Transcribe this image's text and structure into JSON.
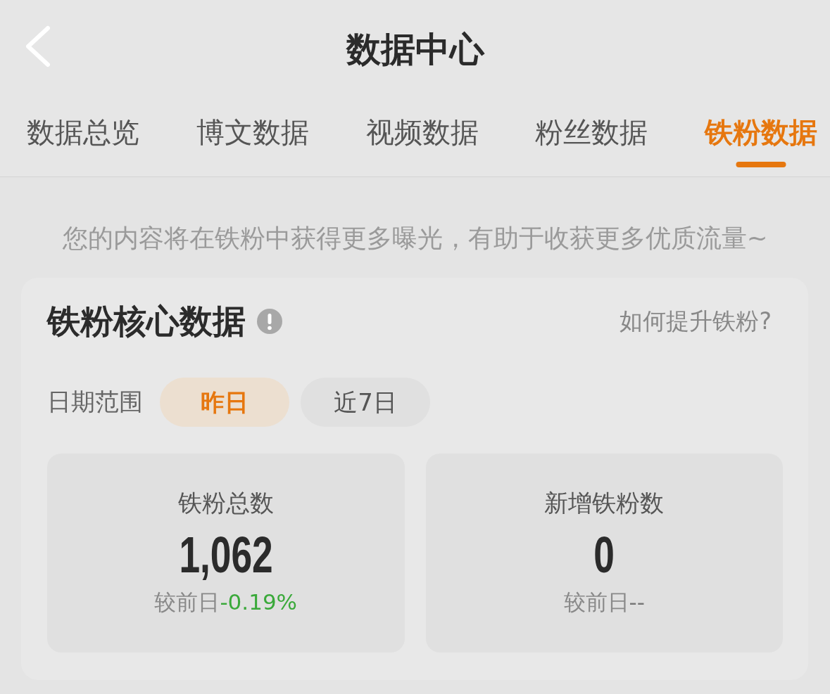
{
  "header": {
    "title": "数据中心"
  },
  "tabs": [
    {
      "label": "数据总览",
      "selected": false
    },
    {
      "label": "博文数据",
      "selected": false
    },
    {
      "label": "视频数据",
      "selected": false
    },
    {
      "label": "粉丝数据",
      "selected": false
    },
    {
      "label": "铁粉数据",
      "selected": true
    }
  ],
  "notice": "您的内容将在铁粉中获得更多曝光，有助于收获更多优质流量~",
  "core_card": {
    "title": "铁粉核心数据",
    "help_link": "如何提升铁粉?",
    "date_range": {
      "label": "日期范围",
      "options": [
        {
          "label": "昨日",
          "selected": true
        },
        {
          "label": "近7日",
          "selected": false
        }
      ]
    },
    "stats": [
      {
        "kind": "decrease",
        "label": "铁粉总数",
        "value": "1,062",
        "comparison_label": "较前日",
        "change": "-0.19%"
      },
      {
        "kind": "flat",
        "label": "新增铁粉数",
        "value": "0",
        "comparison_label": "较前日",
        "change": "--"
      }
    ]
  }
}
